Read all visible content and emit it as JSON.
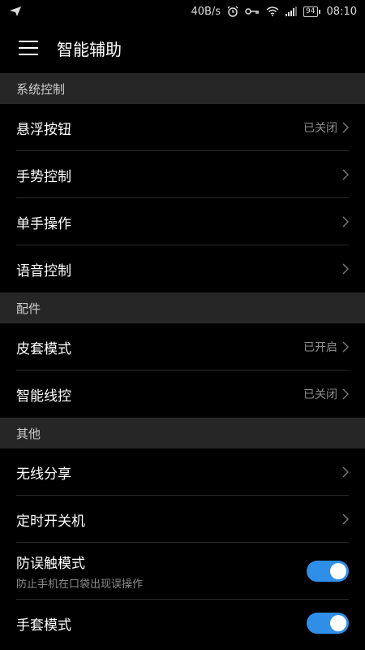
{
  "status_bar": {
    "left_icon": "send-icon",
    "network_speed": "40B/s",
    "icons": [
      "alarm-icon",
      "key-icon",
      "wifi-icon",
      "signal-icon"
    ],
    "battery": "94",
    "time": "08:10"
  },
  "header": {
    "menu_icon": "hamburger-menu-icon",
    "title": "智能辅助"
  },
  "sections": [
    {
      "title": "系统控制",
      "items": [
        {
          "label": "悬浮按钮",
          "value": "已关闭"
        },
        {
          "label": "手势控制",
          "value": ""
        },
        {
          "label": "单手操作",
          "value": ""
        },
        {
          "label": "语音控制",
          "value": ""
        }
      ]
    },
    {
      "title": "配件",
      "items": [
        {
          "label": "皮套模式",
          "value": "已开启"
        },
        {
          "label": "智能线控",
          "value": "已关闭"
        }
      ]
    },
    {
      "title": "其他",
      "items": [
        {
          "label": "无线分享",
          "value": ""
        },
        {
          "label": "定时开关机",
          "value": ""
        },
        {
          "label": "防误触模式",
          "subtitle": "防止手机在口袋出现误操作",
          "toggle": true
        },
        {
          "label": "手套模式",
          "toggle": true
        }
      ]
    }
  ],
  "colors": {
    "background": "#000000",
    "section_header_bg": "#262626",
    "toggle_on": "#2f8fe8",
    "secondary_text": "#8a8a8a"
  }
}
